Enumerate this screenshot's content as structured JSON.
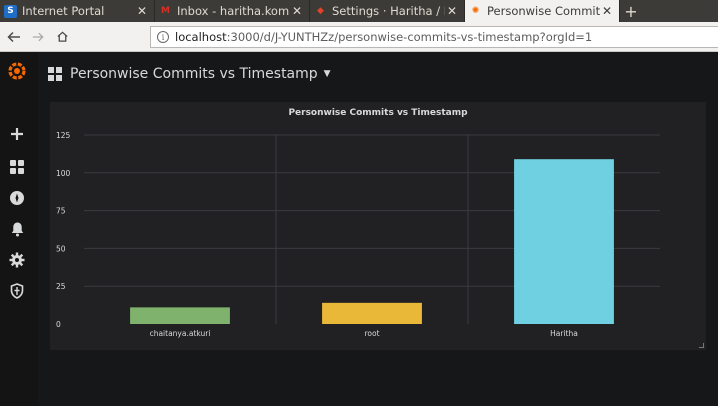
{
  "browser": {
    "tabs": [
      {
        "title": "Internet Portal",
        "favicon": "S",
        "favicon_color": "#1e6ec8",
        "active": false
      },
      {
        "title": "Inbox - haritha.kommire",
        "favicon": "M",
        "favicon_color": "#d93025",
        "active": false
      },
      {
        "title": "Settings · Haritha / HTT",
        "favicon": "◆",
        "favicon_color": "#e2432a",
        "active": false
      },
      {
        "title": "Personwise Commits vs",
        "favicon": "✺",
        "favicon_color": "#f46800",
        "active": true
      }
    ],
    "new_tab": "+",
    "url_host": "localhost",
    "url_rest": ":3000/d/J-YUNTHZz/personwise-commits-vs-timestamp?orgId=1"
  },
  "grafana": {
    "dashboard_title": "Personwise Commits vs Timestamp",
    "sidebar_icons": [
      "grafana-logo-icon",
      "plus-icon",
      "dashboards-icon",
      "explore-icon",
      "alert-bell-icon",
      "gear-icon",
      "shield-icon"
    ],
    "panel_title": "Personwise Commits vs Timestamp"
  },
  "chart_data": {
    "type": "bar",
    "title": "Personwise Commits vs Timestamp",
    "categories": [
      "chaitanya.atkuri",
      "root",
      "Haritha"
    ],
    "values": [
      11,
      14,
      109
    ],
    "colors": [
      "#7eb26d",
      "#eab839",
      "#6ed0e0"
    ],
    "ylim": [
      0,
      125
    ],
    "yticks": [
      "0",
      "25",
      "50",
      "75",
      "100",
      "125"
    ],
    "grid": true
  }
}
